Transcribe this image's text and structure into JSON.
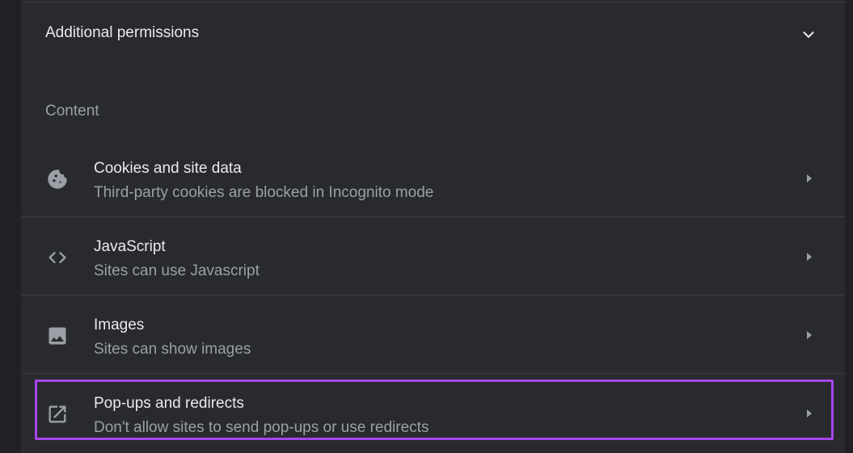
{
  "additional_permissions": {
    "label": "Additional permissions",
    "icon": "chevron-down-icon"
  },
  "content_section": {
    "heading": "Content",
    "items": [
      {
        "title": "Cookies and site data",
        "subtitle": "Third-party cookies are blocked in Incognito mode",
        "icon": "cookie-icon"
      },
      {
        "title": "JavaScript",
        "subtitle": "Sites can use Javascript",
        "icon": "code-icon"
      },
      {
        "title": "Images",
        "subtitle": "Sites can show images",
        "icon": "image-icon"
      },
      {
        "title": "Pop-ups and redirects",
        "subtitle": "Don't allow sites to send pop-ups or use redirects",
        "icon": "open-in-new-icon",
        "highlighted": true
      }
    ]
  },
  "colors": {
    "background": "#202124",
    "card": "#292a2d",
    "divider": "#3c3d40",
    "primary_text": "#e8eaed",
    "secondary_text": "#9aa0a6",
    "highlight": "#a645f0"
  }
}
